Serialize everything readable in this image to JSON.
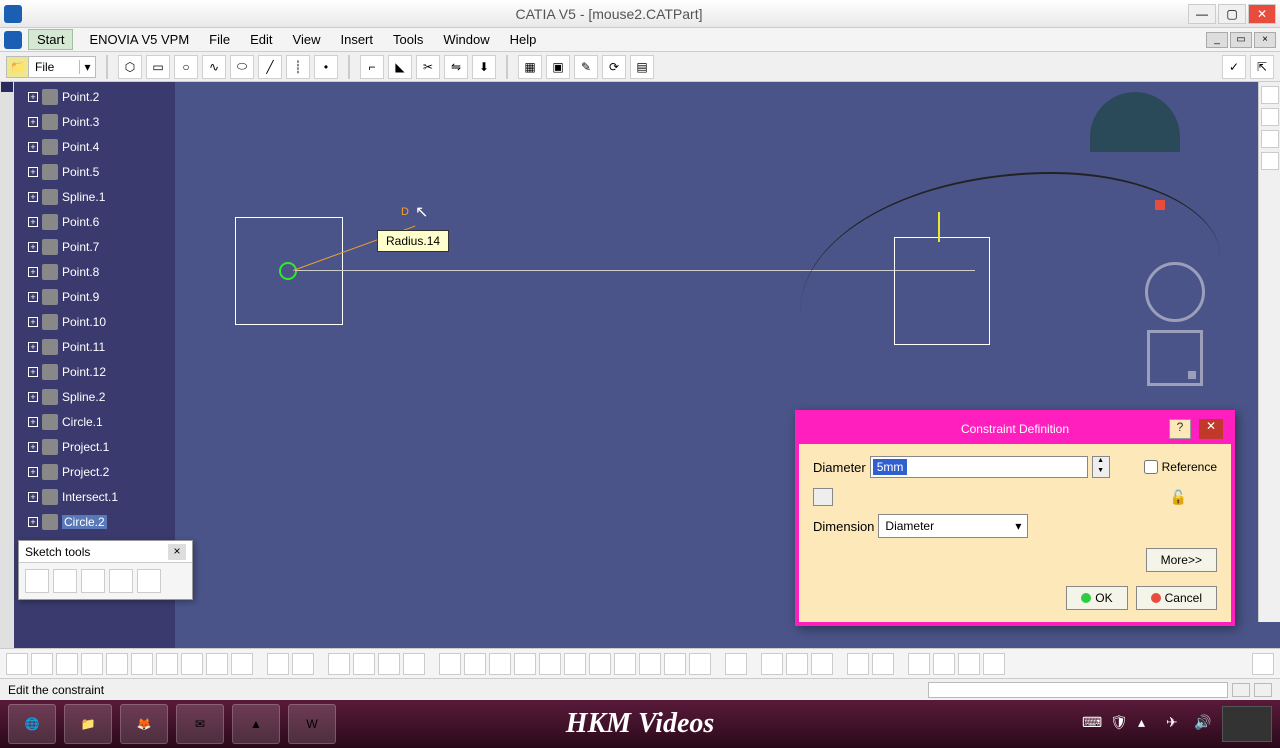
{
  "window": {
    "title": "CATIA V5 - [mouse2.CATPart]"
  },
  "menu": {
    "start": "Start",
    "enovia": "ENOVIA V5 VPM",
    "file": "File",
    "edit": "Edit",
    "view": "View",
    "insert": "Insert",
    "tools": "Tools",
    "window": "Window",
    "help": "Help"
  },
  "file_dropdown": {
    "label": "File"
  },
  "tree": {
    "items": [
      {
        "label": "Point.2"
      },
      {
        "label": "Point.3"
      },
      {
        "label": "Point.4"
      },
      {
        "label": "Point.5"
      },
      {
        "label": "Spline.1"
      },
      {
        "label": "Point.6"
      },
      {
        "label": "Point.7"
      },
      {
        "label": "Point.8"
      },
      {
        "label": "Point.9"
      },
      {
        "label": "Point.10"
      },
      {
        "label": "Point.11"
      },
      {
        "label": "Point.12"
      },
      {
        "label": "Spline.2"
      },
      {
        "label": "Circle.1"
      },
      {
        "label": "Project.1"
      },
      {
        "label": "Project.2"
      },
      {
        "label": "Intersect.1"
      },
      {
        "label": "Circle.2",
        "selected": true
      }
    ]
  },
  "sketch_tools": {
    "title": "Sketch tools"
  },
  "viewport": {
    "tooltip": "Radius.14",
    "dim_prefix": "D"
  },
  "dialog": {
    "title": "Constraint Definition",
    "diameter_label": "Diameter",
    "diameter_value": "5mm",
    "reference_label": "Reference",
    "dimension_label": "Dimension",
    "dimension_value": "Diameter",
    "more": "More>>",
    "ok": "OK",
    "cancel": "Cancel"
  },
  "status": {
    "message": "Edit the constraint"
  },
  "watermark": "HKM Videos"
}
